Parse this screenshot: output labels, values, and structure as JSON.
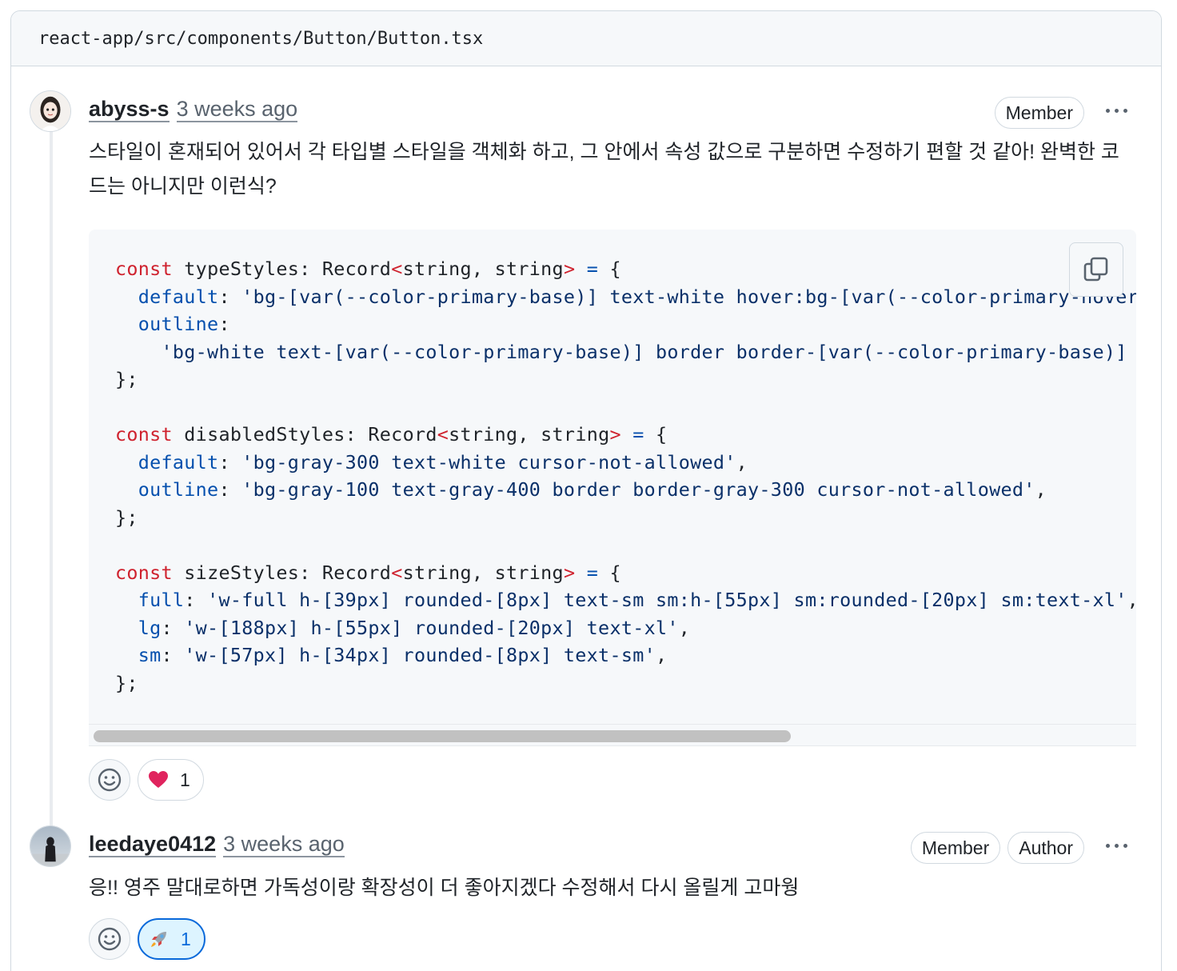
{
  "file_path": "react-app/src/components/Button/Button.tsx",
  "comments": [
    {
      "author": "abyss-s",
      "time": "3 weeks ago",
      "badges": [
        "Member"
      ],
      "body": "스타일이 혼재되어 있어서 각 타입별 스타일을 객체화 하고, 그 안에서 속성 값으로 구분하면 수정하기 편할 것 같아! 완벽한 코드는 아니지만 이런식?",
      "reaction": {
        "emoji": "❤️",
        "count": "1"
      }
    },
    {
      "author": "leedaye0412",
      "time": "3 weeks ago",
      "badges": [
        "Member",
        "Author"
      ],
      "body": "응!! 영주 말대로하면 가독성이랑 확장성이 더 좋아지겠다 수정해서 다시 올릴게 고마웡",
      "reaction": {
        "emoji": "🚀",
        "count": "1"
      }
    }
  ],
  "code": {
    "lines": [
      [
        [
          "kw",
          "const"
        ],
        [
          "plain",
          " typeStyles: Record"
        ],
        [
          "kw",
          "<"
        ],
        [
          "plain",
          "string, string"
        ],
        [
          "kw",
          ">"
        ],
        [
          "prop",
          " ="
        ],
        [
          "plain",
          " {"
        ]
      ],
      [
        [
          "prop",
          "  default"
        ],
        [
          "plain",
          ": "
        ],
        [
          "str",
          "'bg-[var(--color-primary-base)] text-white hover:bg-[var(--color-primary-hover"
        ]
      ],
      [
        [
          "prop",
          "  outline"
        ],
        [
          "plain",
          ":"
        ]
      ],
      [
        [
          "str",
          "    'bg-white text-[var(--color-primary-base)] border border-[var(--color-primary-base)] hover:bg-[var(--color-primary-light)]'"
        ]
      ],
      [
        [
          "plain",
          "};"
        ]
      ],
      [
        [
          "plain",
          ""
        ]
      ],
      [
        [
          "kw",
          "const"
        ],
        [
          "plain",
          " disabledStyles: Record"
        ],
        [
          "kw",
          "<"
        ],
        [
          "plain",
          "string, string"
        ],
        [
          "kw",
          ">"
        ],
        [
          "prop",
          " ="
        ],
        [
          "plain",
          " {"
        ]
      ],
      [
        [
          "prop",
          "  default"
        ],
        [
          "plain",
          ": "
        ],
        [
          "str",
          "'bg-gray-300 text-white cursor-not-allowed'"
        ],
        [
          "plain",
          ","
        ]
      ],
      [
        [
          "prop",
          "  outline"
        ],
        [
          "plain",
          ": "
        ],
        [
          "str",
          "'bg-gray-100 text-gray-400 border border-gray-300 cursor-not-allowed'"
        ],
        [
          "plain",
          ","
        ]
      ],
      [
        [
          "plain",
          "};"
        ]
      ],
      [
        [
          "plain",
          ""
        ]
      ],
      [
        [
          "kw",
          "const"
        ],
        [
          "plain",
          " sizeStyles: Record"
        ],
        [
          "kw",
          "<"
        ],
        [
          "plain",
          "string, string"
        ],
        [
          "kw",
          ">"
        ],
        [
          "prop",
          " ="
        ],
        [
          "plain",
          " {"
        ]
      ],
      [
        [
          "prop",
          "  full"
        ],
        [
          "plain",
          ": "
        ],
        [
          "str",
          "'w-full h-[39px] rounded-[8px] text-sm sm:h-[55px] sm:rounded-[20px] sm:text-xl'"
        ],
        [
          "plain",
          ","
        ]
      ],
      [
        [
          "prop",
          "  lg"
        ],
        [
          "plain",
          ": "
        ],
        [
          "str",
          "'w-[188px] h-[55px] rounded-[20px] text-xl'"
        ],
        [
          "plain",
          ","
        ]
      ],
      [
        [
          "prop",
          "  sm"
        ],
        [
          "plain",
          ": "
        ],
        [
          "str",
          "'w-[57px] h-[34px] rounded-[8px] text-sm'"
        ],
        [
          "plain",
          ","
        ]
      ],
      [
        [
          "plain",
          "};"
        ]
      ]
    ]
  },
  "colors": {
    "keyword": "#cf222e",
    "property": "#0550ae",
    "string": "#0a3069",
    "accent": "#0969da"
  },
  "icons": [
    "copy-icon",
    "smiley-icon",
    "kebab-menu-icon"
  ]
}
